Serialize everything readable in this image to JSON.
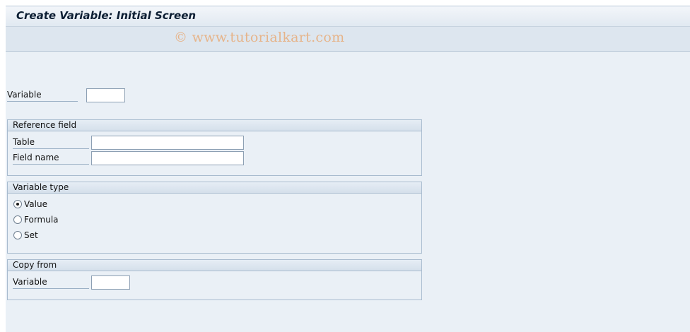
{
  "header": {
    "title": "Create Variable: Initial Screen",
    "watermark": "© www.tutorialkart.com"
  },
  "variable": {
    "label": "Variable",
    "value": ""
  },
  "reference_field": {
    "title": "Reference field",
    "table_label": "Table",
    "table_value": "",
    "field_name_label": "Field name",
    "field_name_value": ""
  },
  "variable_type": {
    "title": "Variable type",
    "options": [
      {
        "label": "Value",
        "selected": true
      },
      {
        "label": "Formula",
        "selected": false
      },
      {
        "label": "Set",
        "selected": false
      }
    ]
  },
  "copy_from": {
    "title": "Copy from",
    "variable_label": "Variable",
    "variable_value": ""
  },
  "colors": {
    "screen_background": "#eaf0f6",
    "watermark": "#e6b48a",
    "title_text": "#0c1e33"
  }
}
